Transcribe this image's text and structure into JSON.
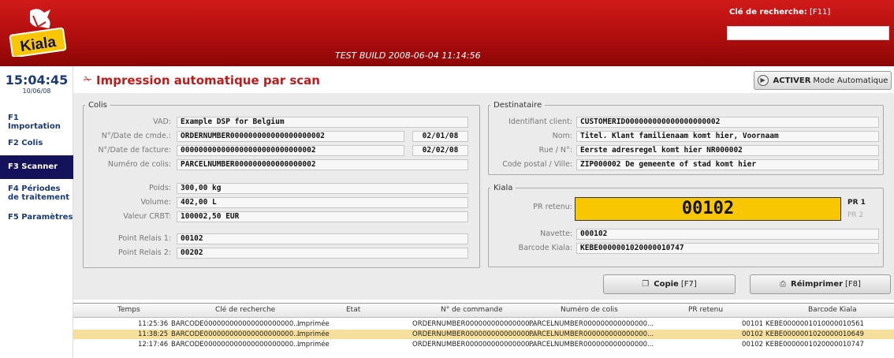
{
  "header": {
    "build": "TEST BUILD 2008-06-04 11:14:56",
    "search_label": "Clé de recherche:",
    "search_shortcut": "[F11]",
    "search_value": "",
    "logo_text": "Kiala"
  },
  "sidebar": {
    "time": "15:04:45",
    "date": "10/06/08",
    "items": [
      {
        "label": "F1 Importation"
      },
      {
        "label": "F2 Colis"
      },
      {
        "label": "F3 Scanner"
      },
      {
        "label": "F4 Périodes de traitement"
      },
      {
        "label": "F5 Paramètres"
      }
    ],
    "active_index": 2
  },
  "page": {
    "title": "Impression automatique par scan",
    "auto_button_bold": "ACTIVER",
    "auto_button_rest": "Mode Automatique"
  },
  "colis": {
    "legend": "Colis",
    "vad_label": "VAD:",
    "vad": "Example DSP for Belgium",
    "cmde_label": "N°/Date de cmde.:",
    "cmde": "ORDERNUMBER000000000000000000002",
    "cmde_date": "02/01/08",
    "facture_label": "N°/Date de facture:",
    "facture": "000000000000000000000000000002",
    "facture_date": "02/02/08",
    "numero_label": "Numéro de colis:",
    "numero": "PARCELNUMBER000000000000000002",
    "poids_label": "Poids:",
    "poids": "300,00 kg",
    "volume_label": "Volume:",
    "volume": "402,00 L",
    "crbt_label": "Valeur CRBT:",
    "crbt": "100002,50 EUR",
    "pr1_label": "Point Relais 1:",
    "pr1": "00102",
    "pr2_label": "Point Relais 2:",
    "pr2": "00202"
  },
  "destinataire": {
    "legend": "Destinataire",
    "client_label": "Identifiant client:",
    "client": "CUSTOMERID000000000000000000002",
    "nom_label": "Nom:",
    "nom": "Titel. Klant familienaam komt hier, Voornaam",
    "rue_label": "Rue / N°:",
    "rue": "Eerste adresregel komt hier NR000002",
    "cp_label": "Code postal / Ville:",
    "cp": "ZIP000002 De gemeente of stad komt hier"
  },
  "kiala": {
    "legend": "Kiala",
    "retenu_label": "PR retenu:",
    "retenu": "00102",
    "pr1": "PR 1",
    "pr2": "PR 2",
    "navette_label": "Navette:",
    "navette": "000102",
    "barcode_label": "Barcode Kiala:",
    "barcode": "KEBE0000001020000010747"
  },
  "actions": {
    "copy_label": "Copie",
    "copy_shortcut": "[F7]",
    "reprint_label": "Réimprimer",
    "reprint_shortcut": "[F8]"
  },
  "table": {
    "headers": [
      "Temps",
      "Clé de recherche",
      "Etat",
      "N° de commande",
      "Numéro de colis",
      "PR retenu",
      "Barcode Kiala"
    ],
    "rows": [
      {
        "temps": "11:25:36",
        "cle": "BARCODE000000000000000000000...",
        "etat": "Imprimée",
        "cmd": "ORDERNUMBER000000000000000...",
        "colis": "PARCELNUMBER000000000000000...",
        "pr": "00101",
        "barcode": "KEBE0000001010000010561",
        "selected": false
      },
      {
        "temps": "11:38:25",
        "cle": "BARCODE000000000000000000000...",
        "etat": "Imprimée",
        "cmd": "ORDERNUMBER000000000000000...",
        "colis": "PARCELNUMBER000000000000000...",
        "pr": "00102",
        "barcode": "KEBE0000001020000010649",
        "selected": true
      },
      {
        "temps": "12:17:46",
        "cle": "BARCODE000000000000000000000...",
        "etat": "Imprimée",
        "cmd": "ORDERNUMBER000000000000000...",
        "colis": "PARCELNUMBER000000000000000...",
        "pr": "00102",
        "barcode": "KEBE0000001020000010747",
        "selected": false
      }
    ]
  },
  "colors": {
    "header_red": "#c21a1a",
    "nav_active": "#13125a",
    "pr_yellow": "#f8c701",
    "row_selected": "#f6df9d"
  }
}
